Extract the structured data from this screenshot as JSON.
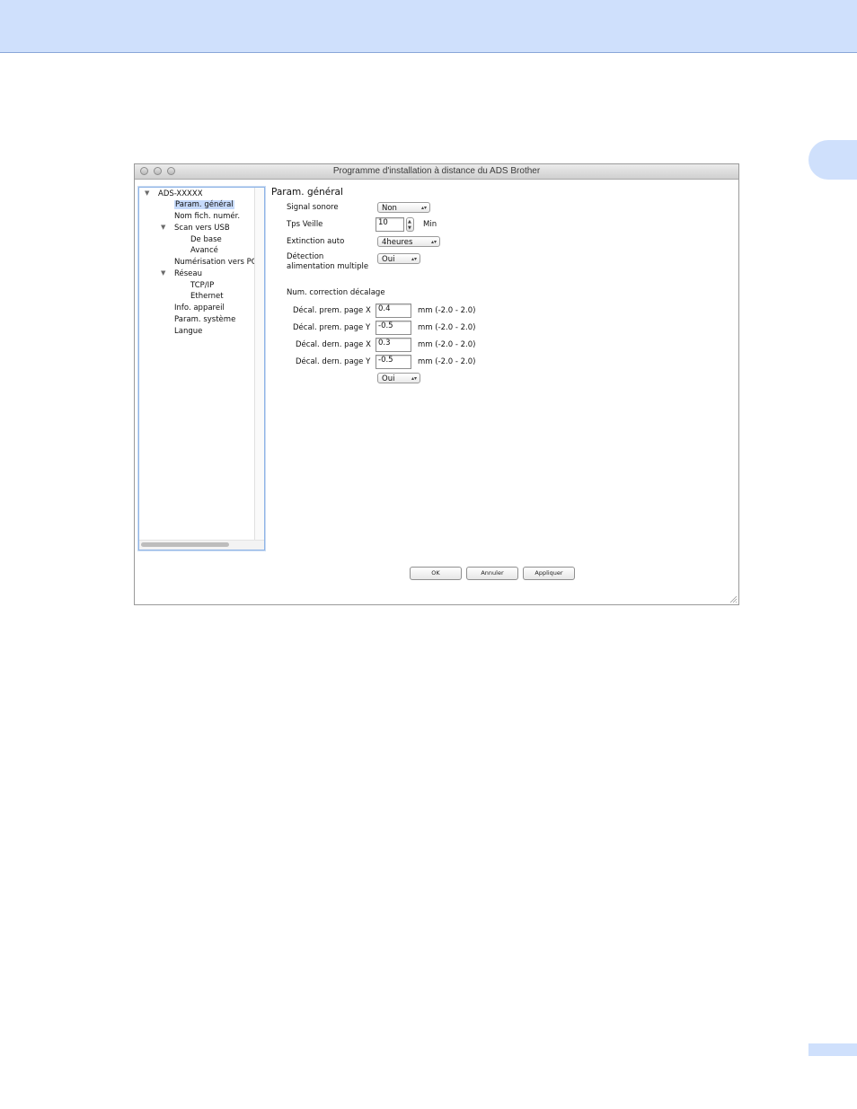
{
  "window": {
    "title": "Programme d'installation à distance du ADS Brother"
  },
  "tree": {
    "root": "ADS-XXXXX",
    "items": [
      {
        "label": "Param. général",
        "selected": true
      },
      {
        "label": "Nom fich. numér."
      },
      {
        "label": "Scan vers USB",
        "expanded": true
      },
      {
        "label": "De base"
      },
      {
        "label": "Avancé"
      },
      {
        "label": "Numérisation vers PC"
      },
      {
        "label": "Réseau",
        "expanded": true
      },
      {
        "label": "TCP/IP"
      },
      {
        "label": "Ethernet"
      },
      {
        "label": "Info. appareil"
      },
      {
        "label": "Param. système"
      },
      {
        "label": "Langue"
      }
    ]
  },
  "panel": {
    "title": "Param. général",
    "signal_sonore": {
      "label": "Signal sonore",
      "value": "Non"
    },
    "tps_veille": {
      "label": "Tps Veille",
      "value": "10",
      "unit": "Min"
    },
    "extinction_auto": {
      "label": "Extinction auto",
      "value": "4heures"
    },
    "detection": {
      "label_line1": "Détection",
      "label_line2": "alimentation multiple",
      "value": "Oui"
    },
    "offset_section": "Num. correction décalage",
    "offsets": [
      {
        "label": "Décal. prem. page X",
        "value": "0.4",
        "range": "mm (-2.0 - 2.0)"
      },
      {
        "label": "Décal. prem. page Y",
        "value": "-0.5",
        "range": "mm (-2.0 - 2.0)"
      },
      {
        "label": "Décal. dern. page X",
        "value": "0.3",
        "range": "mm (-2.0 - 2.0)"
      },
      {
        "label": "Décal. dern. page Y",
        "value": "-0.5",
        "range": "mm (-2.0 - 2.0)"
      }
    ],
    "offset_toggle": "Oui"
  },
  "buttons": {
    "ok": "OK",
    "cancel": "Annuler",
    "apply": "Appliquer"
  },
  "colors": {
    "header": "#cfe0fc",
    "selection": "#c6dafb",
    "tree_border": "#8fb4e6"
  }
}
